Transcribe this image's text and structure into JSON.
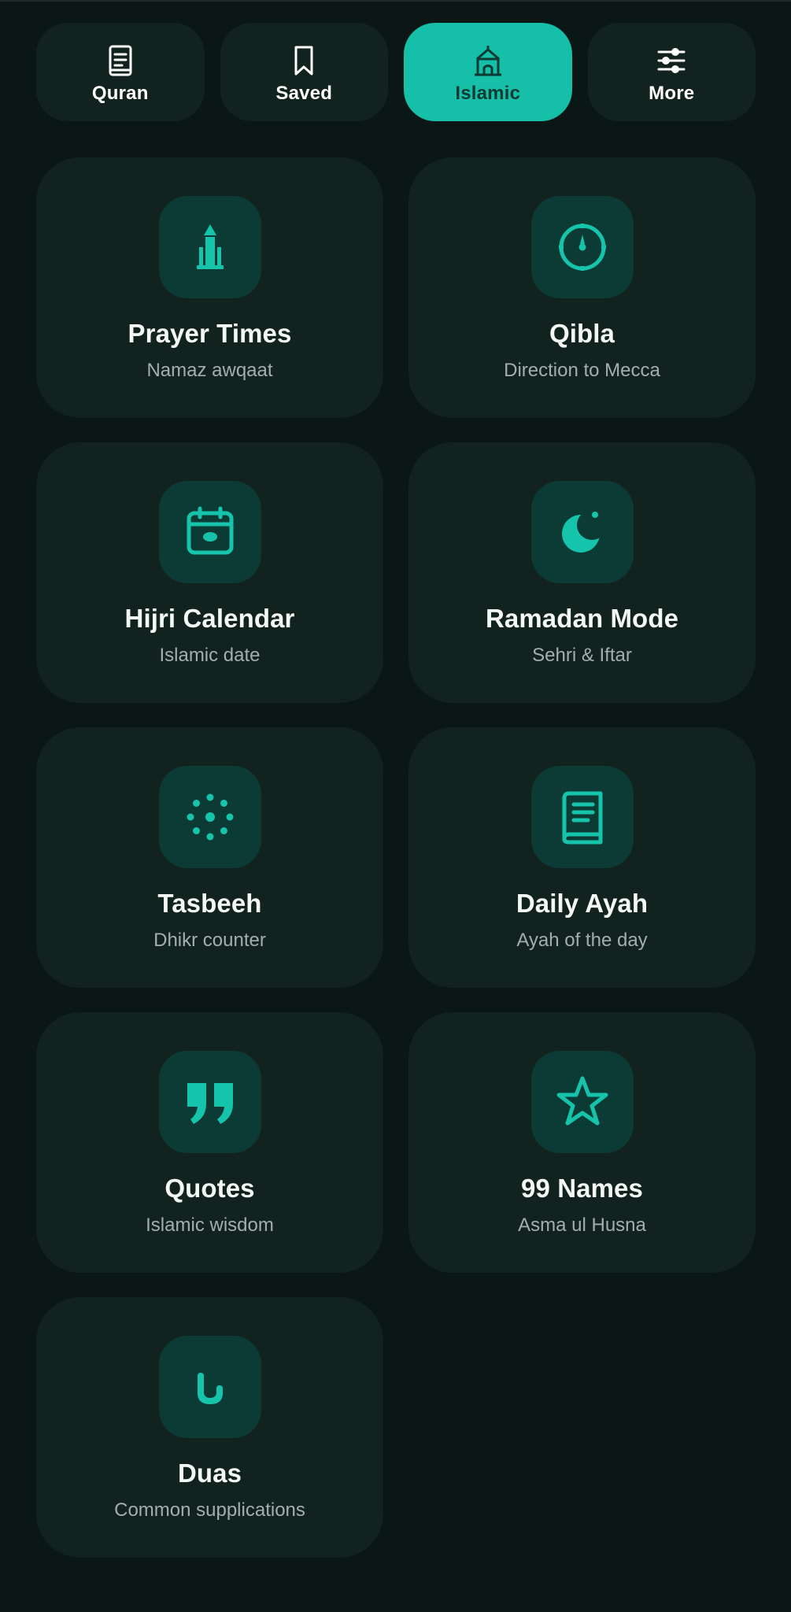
{
  "colors": {
    "background": "#0a1715",
    "card": "#12231f",
    "icon_tile": "#0c3b35",
    "accent": "#16bfa8",
    "accent_icon": "#15c4ab",
    "title": "#f3f7f6",
    "subtitle": "#a3afad"
  },
  "nav": {
    "tabs": [
      {
        "label": "Quran",
        "icon": "book-icon",
        "active": false
      },
      {
        "label": "Saved",
        "icon": "bookmark-icon",
        "active": false
      },
      {
        "label": "Islamic",
        "icon": "mosque-icon",
        "active": true
      },
      {
        "label": "More",
        "icon": "sliders-icon",
        "active": false
      }
    ]
  },
  "features": [
    {
      "title": "Prayer Times",
      "subtitle": "Namaz awqaat",
      "icon": "minaret-icon"
    },
    {
      "title": "Qibla",
      "subtitle": "Direction to Mecca",
      "icon": "compass-icon"
    },
    {
      "title": "Hijri Calendar",
      "subtitle": "Islamic date",
      "icon": "calendar-icon"
    },
    {
      "title": "Ramadan Mode",
      "subtitle": "Sehri & Iftar",
      "icon": "crescent-moon-icon"
    },
    {
      "title": "Tasbeeh",
      "subtitle": "Dhikr counter",
      "icon": "prayer-beads-icon"
    },
    {
      "title": "Daily Ayah",
      "subtitle": "Ayah of the day",
      "icon": "book-page-icon"
    },
    {
      "title": "Quotes",
      "subtitle": "Islamic wisdom",
      "icon": "quote-icon"
    },
    {
      "title": "99 Names",
      "subtitle": "Asma ul Husna",
      "icon": "star-icon"
    },
    {
      "title": "Duas",
      "subtitle": "Common supplications",
      "icon": "praying-hands-icon"
    }
  ]
}
